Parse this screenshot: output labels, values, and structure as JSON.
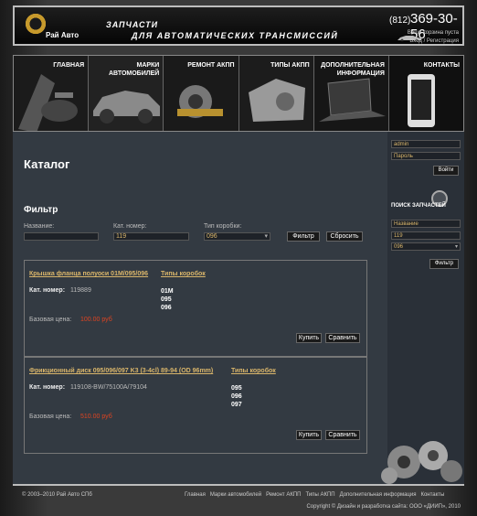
{
  "header": {
    "logo_text": "Рай Авто",
    "slogan_line1": "ЗАПЧАСТИ",
    "slogan_line2": "ДЛЯ АВТОМАТИЧЕСКИХ ТРАНСМИССИЙ",
    "phone_code": "(812)",
    "phone_number": "369-30-56",
    "cart_status": "Ваша корзина пуста",
    "login_link": "Вход",
    "register_link": "Регистрация"
  },
  "nav": [
    {
      "label": "ГЛАВНАЯ"
    },
    {
      "label": "МАРКИ\nАВТОМОБИЛЕЙ"
    },
    {
      "label": "РЕМОНТ АКПП"
    },
    {
      "label": "ТИПЫ АКПП"
    },
    {
      "label": "ДОПОЛНИТЕЛЬНАЯ\nИНФОРМАЦИЯ"
    },
    {
      "label": "КОНТАКТЫ"
    }
  ],
  "catalog": {
    "title": "Каталог",
    "filter_title": "Фильтр",
    "name_label": "Название:",
    "name_value": "",
    "catnum_label": "Кат. номер:",
    "catnum_value": "119",
    "box_label": "Тип коробки:",
    "box_value": "096",
    "filter_button": "Фильтр",
    "reset_button": "Сбросить"
  },
  "products": [
    {
      "name": "Крышка фланца полуоси 01M/095/096",
      "types_link": "Типы коробок",
      "catnum_label": "Кат. номер:",
      "catnum": "119889",
      "boxes": [
        "01M",
        "095",
        "096"
      ],
      "price_label": "Базовая цена:",
      "price": "100.00 руб",
      "buy": "Купить",
      "compare": "Сравнить"
    },
    {
      "name": "Фрикционный диск 095/096/097 K3 (3-4cl) 89-94 (OD 96mm)",
      "types_link": "Типы коробок",
      "catnum_label": "Кат. номер:",
      "catnum": "119108-BW/75100A/79104",
      "boxes": [
        "095",
        "096",
        "097"
      ],
      "price_label": "Базовая цена:",
      "price": "510.00 руб",
      "buy": "Купить",
      "compare": "Сравнить"
    }
  ],
  "sidebar": {
    "login_value": "admin",
    "password_placeholder": "Пароль",
    "login_button": "Войти",
    "search_title": "ПОИСК ЗАПЧАСТЕЙ",
    "name_placeholder": "Название",
    "catnum_value": "119",
    "box_value": "096",
    "filter_button": "Фильтр"
  },
  "footer": {
    "copyright": "© 2003–2010 Рай Авто СПб",
    "links": [
      "Главная",
      "Марки автомобилей",
      "Ремонт АКПП",
      "Типы АКПП",
      "Дополнительная информация",
      "Контакты"
    ],
    "credit": "Copyright © Дизайн и разработка сайта: ООО «ДИИП», 2010"
  },
  "colors": {
    "accent_link": "#d9b56a",
    "price": "#dd4422",
    "content_bg": "#333a42"
  }
}
